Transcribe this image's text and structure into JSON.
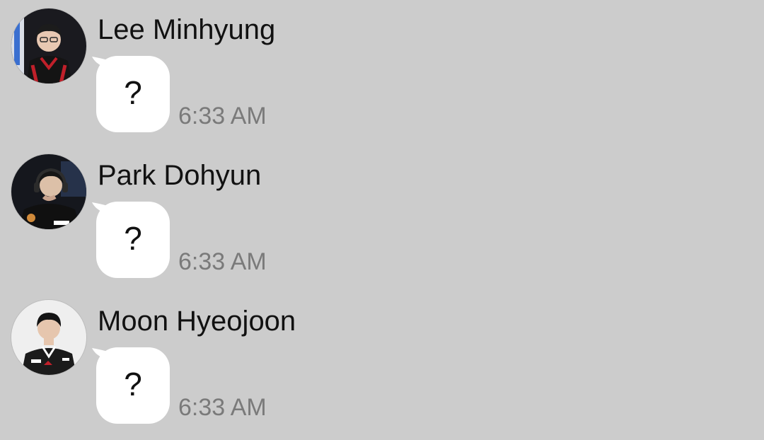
{
  "chat": {
    "messages": [
      {
        "sender": "Lee Minhyung",
        "text": "?",
        "time": "6:33 AM",
        "avatar_icon": "profile-photo-icon"
      },
      {
        "sender": "Park Dohyun",
        "text": "?",
        "time": "6:33 AM",
        "avatar_icon": "profile-photo-icon"
      },
      {
        "sender": "Moon Hyeojoon",
        "text": "?",
        "time": "6:33 AM",
        "avatar_icon": "profile-photo-icon"
      }
    ]
  },
  "colors": {
    "background": "#cccccc",
    "bubble": "#ffffff",
    "sender_text": "#111111",
    "time_text": "#7a7a7a"
  }
}
